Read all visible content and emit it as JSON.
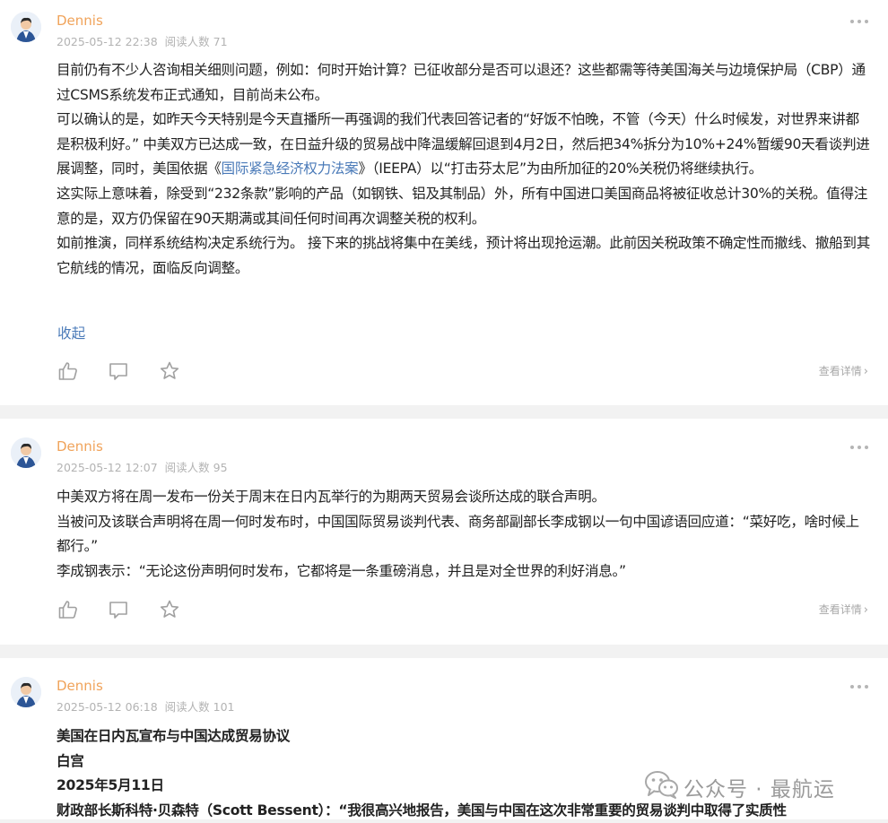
{
  "posts": [
    {
      "author": "Dennis",
      "date": "2025-05-12 22:38",
      "views": "阅读人数 71",
      "paragraphs": [
        "目前仍有不少人咨询相关细则问题，例如：何时开始计算？已征收部分是否可以退还？这些都需等待美国海关与边境保护局（CBP）通过CSMS系统发布正式通知，目前尚未公布。",
        "可以确认的是，如昨天今天特别是今天直播所一再强调的我们代表回答记者的“好饭不怕晚，不管（今天）什么时候发，对世界来讲都是积极利好。” 中美双方已达成一致，在日益升级的贸易战中降温缓解回退到4月2日，然后把34%拆分为10%+24%暂缓90天看谈判进展调整，同时，美国依据",
        "国际紧急经济权力法案",
        "》（IEEPA）以“打击芬太尼”为由所加征的20%关税仍将继续执行。",
        "这实际上意味着，除受到“232条款”影响的产品（如钢铁、铝及其制品）外，所有中国进口美国商品将被征收总计30%的关税。值得注意的是，双方仍保留在90天期满或其间任何时间再次调整关税的权利。",
        "如前推演，同样系统结构决定系统行为。 接下来的挑战将集中在美线，预计将出现抢运潮。此前因关税政策不确定性而撤线、撤船到其它航线的情况，面临反向调整。"
      ],
      "link_prefix": "《",
      "collapse": "收起",
      "detail": "查看详情"
    },
    {
      "author": "Dennis",
      "date": "2025-05-12 12:07",
      "views": "阅读人数 95",
      "paragraphs": [
        "中美双方将在周一发布一份关于周末在日内瓦举行的为期两天贸易会谈所达成的联合声明。",
        "当被问及该联合声明将在周一何时发布时，中国国际贸易谈判代表、商务部副部长李成钢以一句中国谚语回应道：“菜好吃，啥时候上都行。”",
        "李成钢表示：“无论这份声明何时发布，它都将是一条重磅消息，并且是对全世界的利好消息。”"
      ],
      "detail": "查看详情"
    },
    {
      "author": "Dennis",
      "date": "2025-05-12 06:18",
      "views": "阅读人数 101",
      "paragraphs": [
        "美国在日内瓦宣布与中国达成贸易协议",
        "白宫",
        "2025年5月11日",
        "财政部长斯科特·贝森特（Scott Bessent）：“我很高兴地报告，美国与中国在这次非常重要的贸易谈判中取得了实质性"
      ]
    }
  ],
  "watermark": "公众号 · 最航运",
  "colors": {
    "author": "#f0a35a",
    "link": "#4a7ab8",
    "meta": "#b3b3b3",
    "separator": "#f2f2f2"
  }
}
